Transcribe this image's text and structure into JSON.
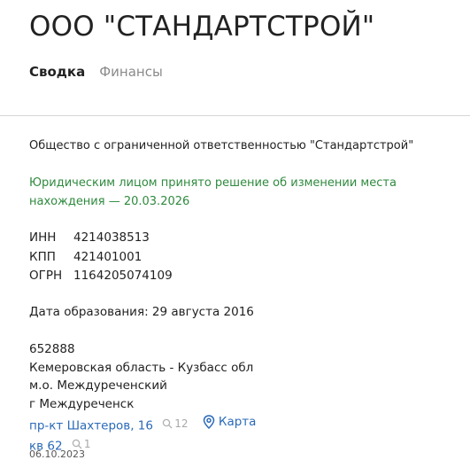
{
  "company": {
    "title": "ООО \"СТАНДАРТСТРОЙ\"",
    "full_name": "Общество с ограниченной ответственностью \"Стандартстрой\""
  },
  "tabs": [
    {
      "label": "Сводка",
      "active": true
    },
    {
      "label": "Финансы",
      "active": false
    }
  ],
  "notice": "Юридическим лицом принято решение об изменении места нахождения — 20.03.2026",
  "codes": [
    {
      "key": "ИНН",
      "value": "4214038513"
    },
    {
      "key": "КПП",
      "value": "421401001"
    },
    {
      "key": "ОГРН",
      "value": "1164205074109"
    }
  ],
  "founded": "Дата образования: 29 августа 2016",
  "address": {
    "postal": "652888",
    "region": "Кемеровская область - Кузбасс обл",
    "district": "м.о. Междуреченский",
    "city": "г Междуреченск",
    "street": "пр-кт Шахтеров, 16",
    "street_count": "12",
    "map_label": "Карта",
    "apartment": "кв 62",
    "apartment_count": "1"
  },
  "cut_text": "06.10.2023",
  "colors": {
    "link": "#2a6ab8",
    "notice": "#2e8a3e",
    "muted": "#8a8a8a"
  },
  "icons": [
    "search-icon",
    "map-pin-icon"
  ]
}
